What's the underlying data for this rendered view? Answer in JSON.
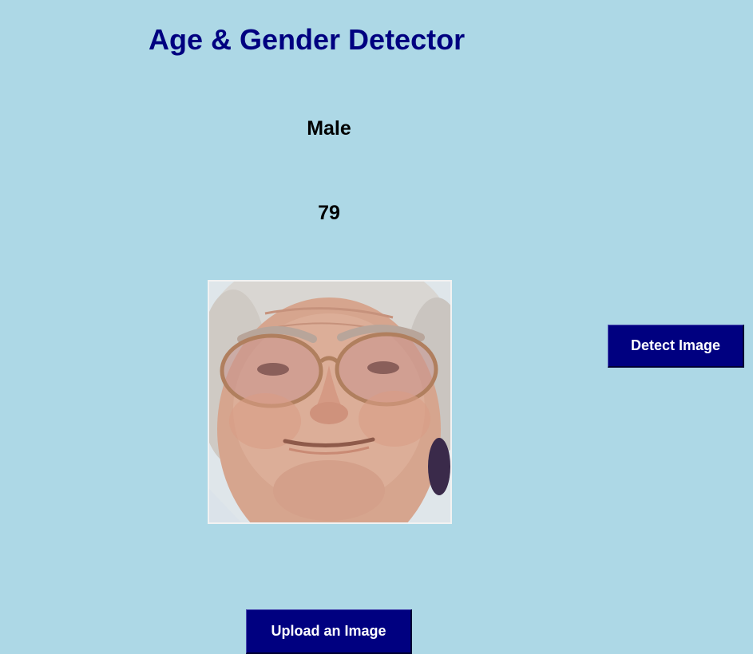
{
  "header": {
    "title": "Age & Gender Detector"
  },
  "result": {
    "gender": "Male",
    "age": "79"
  },
  "image": {
    "alt": "Uploaded face photo"
  },
  "actions": {
    "detect_label": "Detect Image",
    "upload_label": "Upload an Image"
  },
  "colors": {
    "background": "#add8e6",
    "title": "#000080",
    "button": "#000080",
    "button_text": "#ffffff"
  }
}
